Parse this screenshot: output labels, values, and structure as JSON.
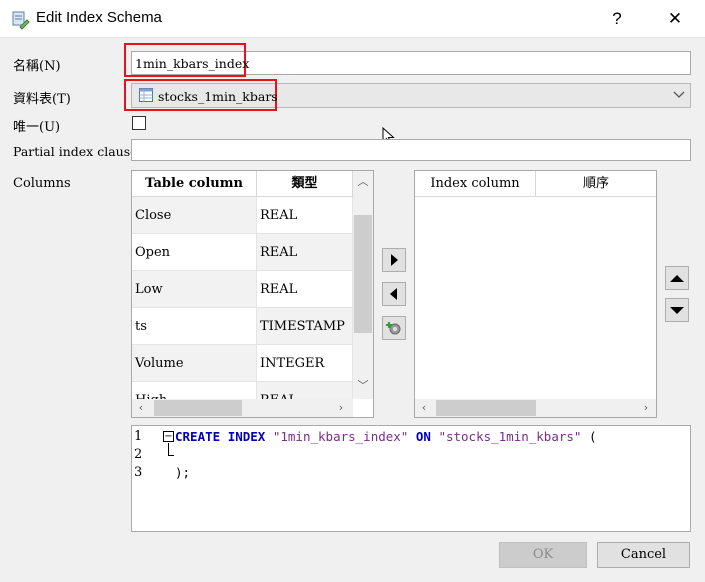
{
  "window": {
    "title": "Edit Index Schema",
    "help_glyph": "?",
    "close_glyph": "✕",
    "icon": "schema-edit-icon"
  },
  "form": {
    "name_label": "名稱(N)",
    "name_value": "1min_kbars_index",
    "table_label": "資料表(T)",
    "table_value": "stocks_1min_kbars",
    "table_icon": "table-icon",
    "unique_label": "唯一(U)",
    "partial_label": "Partial index clause",
    "partial_value": "",
    "columns_label": "Columns"
  },
  "columns_table": {
    "headers": [
      "Table column",
      "類型"
    ],
    "rows": [
      {
        "name": "Close",
        "type": "REAL"
      },
      {
        "name": "Open",
        "type": "REAL"
      },
      {
        "name": "Low",
        "type": "REAL"
      },
      {
        "name": "ts",
        "type": "TIMESTAMP"
      },
      {
        "name": "Volume",
        "type": "INTEGER"
      },
      {
        "name": "High",
        "type": "REAL"
      }
    ]
  },
  "index_table": {
    "headers": [
      "Index column",
      "順序"
    ]
  },
  "editor": {
    "line_numbers": [
      "1",
      "2",
      "3"
    ],
    "kw_create": "CREATE",
    "kw_index": "INDEX",
    "str_index": "\"1min_kbars_index\"",
    "kw_on": "ON",
    "str_table": "\"stocks_1min_kbars\"",
    "open_paren": "(",
    "close_line": ");",
    "fold_glyph": "−"
  },
  "buttons": {
    "ok": "OK",
    "cancel": "Cancel"
  },
  "colors": {
    "highlight_box": "#e8121b",
    "keyword": "#0000c0",
    "string": "#7a2d8c"
  }
}
